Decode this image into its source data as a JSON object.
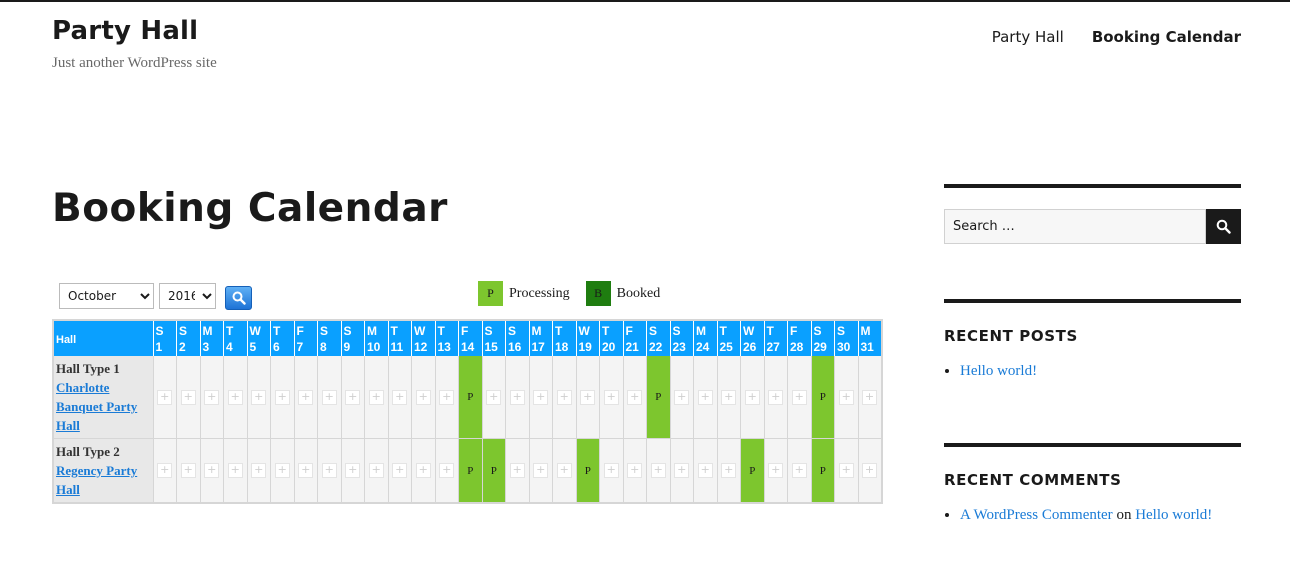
{
  "site": {
    "title": "Party Hall",
    "description": "Just another WordPress site"
  },
  "nav": {
    "items": [
      "Party Hall",
      "Booking Calendar"
    ],
    "current": "Booking Calendar"
  },
  "page": {
    "title": "Booking Calendar"
  },
  "controls": {
    "month": "October",
    "year": "2016",
    "search_icon": "magnifier-icon"
  },
  "legend": {
    "processing": {
      "code": "P",
      "label": "Processing",
      "color": "#7dc62e"
    },
    "booked": {
      "code": "B",
      "label": "Booked",
      "color": "#1f7d10"
    }
  },
  "calendar": {
    "hall_header": "Hall",
    "header_color": "#0aa0ff",
    "days": [
      {
        "d": "S",
        "n": "1"
      },
      {
        "d": "S",
        "n": "2"
      },
      {
        "d": "M",
        "n": "3"
      },
      {
        "d": "T",
        "n": "4"
      },
      {
        "d": "W",
        "n": "5"
      },
      {
        "d": "T",
        "n": "6"
      },
      {
        "d": "F",
        "n": "7"
      },
      {
        "d": "S",
        "n": "8"
      },
      {
        "d": "S",
        "n": "9"
      },
      {
        "d": "M",
        "n": "10"
      },
      {
        "d": "T",
        "n": "11"
      },
      {
        "d": "W",
        "n": "12"
      },
      {
        "d": "T",
        "n": "13"
      },
      {
        "d": "F",
        "n": "14"
      },
      {
        "d": "S",
        "n": "15"
      },
      {
        "d": "S",
        "n": "16"
      },
      {
        "d": "M",
        "n": "17"
      },
      {
        "d": "T",
        "n": "18"
      },
      {
        "d": "W",
        "n": "19"
      },
      {
        "d": "T",
        "n": "20"
      },
      {
        "d": "F",
        "n": "21"
      },
      {
        "d": "S",
        "n": "22"
      },
      {
        "d": "S",
        "n": "23"
      },
      {
        "d": "M",
        "n": "24"
      },
      {
        "d": "T",
        "n": "25"
      },
      {
        "d": "W",
        "n": "26"
      },
      {
        "d": "T",
        "n": "27"
      },
      {
        "d": "F",
        "n": "28"
      },
      {
        "d": "S",
        "n": "29"
      },
      {
        "d": "S",
        "n": "30"
      },
      {
        "d": "M",
        "n": "31"
      }
    ],
    "halls": [
      {
        "type": "Hall Type 1",
        "name": "Charlotte Banquet Party Hall",
        "processing_days": [
          14,
          22,
          29
        ],
        "status_code": "P"
      },
      {
        "type": "Hall Type 2",
        "name": "Regency Party Hall",
        "processing_days": [
          14,
          15,
          19,
          26,
          29
        ],
        "status_code": "P"
      }
    ]
  },
  "sidebar": {
    "search": {
      "placeholder": "Search …"
    },
    "recent_posts": {
      "title": "RECENT POSTS",
      "items": [
        "Hello world!"
      ]
    },
    "recent_comments": {
      "title": "RECENT COMMENTS",
      "items": [
        {
          "author": "A WordPress Commenter",
          "on": "on",
          "post": "Hello world!"
        }
      ]
    }
  }
}
